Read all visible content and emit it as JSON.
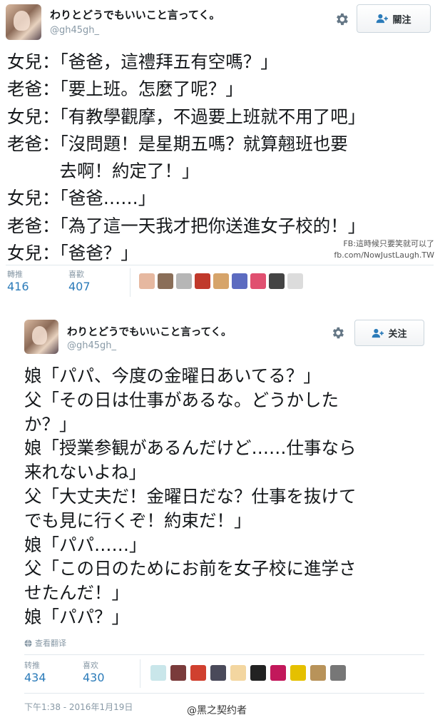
{
  "tweet1": {
    "display_name": "わりとどうでもいいこと言ってく。",
    "handle": "@gh45gh_",
    "follow_label": "關注",
    "lines": [
      "女兒：「爸爸，這禮拜五有空嗎？」",
      "老爸：「要上班。怎麼了呢？」",
      "女兒：「有教學觀摩，不過要上班就不用了吧」",
      "老爸：「沒問題！是星期五嗎？就算翹班也要",
      "　　　去啊！約定了！」",
      "女兒：「爸爸……」",
      "老爸：「為了這一天我才把你送進女子校的！」",
      "女兒：「爸爸？」"
    ],
    "watermark_line1": "FB:這時候只要笑就可以了",
    "watermark_line2": "fb.com/NowJustLaugh.TW",
    "retweets_label": "轉推",
    "retweets_value": "416",
    "likes_label": "喜歡",
    "likes_value": "407"
  },
  "tweet2": {
    "display_name": "わりとどうでもいいこと言ってく。",
    "handle": "@gh45gh_",
    "follow_label": "关注",
    "lines": [
      "娘「パパ、今度の金曜日あいてる？」",
      "父「その日は仕事があるな。どうかした",
      "か？」",
      "娘「授業参観があるんだけど……仕事なら",
      "来れないよね」",
      "父「大丈夫だ！金曜日だな？仕事を抜けて",
      "でも見に行くぞ！約束だ！」",
      "娘「パパ……」",
      "父「この日のためにお前を女子校に進学さ",
      "せたんだ！」",
      "娘「パパ？」"
    ],
    "translate_label": "查看翻译",
    "retweets_label": "转推",
    "retweets_value": "434",
    "likes_label": "喜欢",
    "likes_value": "430",
    "timestamp": "下午1:38 - 2016年1月19日"
  },
  "weibo_watermark": "@黑之契约者",
  "colors": {
    "link_blue": "#2b7bb9",
    "muted": "#8899a6",
    "divider": "#e1e8ed",
    "text": "#14171a"
  },
  "icons": {
    "settings": "gear-icon",
    "follow": "add-user-icon",
    "translate": "globe-icon"
  }
}
